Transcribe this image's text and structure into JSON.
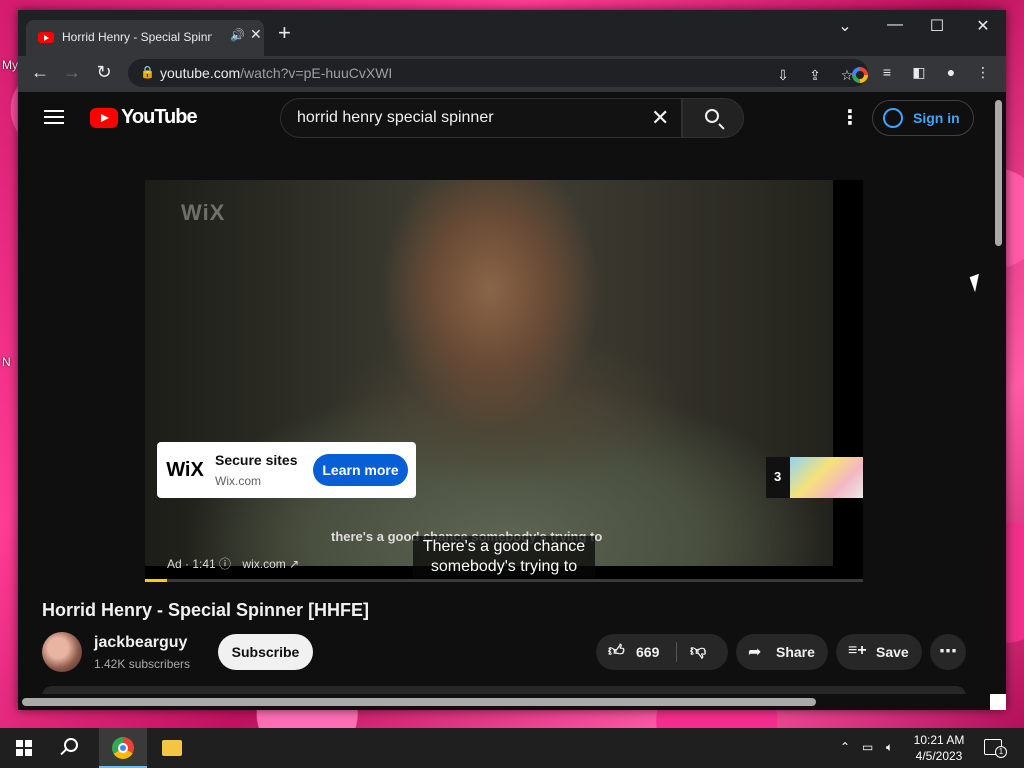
{
  "desktop": {
    "label_top": "My",
    "label_bottom": "N"
  },
  "browser": {
    "tab_title": "Horrid Henry - Special Spinner [HHFE] - YouTube",
    "tab_audio_icon": "speaker-icon",
    "url_host": "youtube.com",
    "url_path": "/watch?v=pE-huuCvXWI"
  },
  "youtube": {
    "logo_text": "YouTube",
    "search_query": "horrid henry special spinner",
    "signin_label": "Sign in",
    "ad": {
      "watermark": "WiX",
      "logo_text": "WiX",
      "title": "Secure sites",
      "domain": "Wix.com",
      "cta": "Learn more",
      "caption_in_ad": "there's a good chance somebody's trying to",
      "info_label": "Ad · 1:41",
      "info_domain": "wix.com"
    },
    "caption_line1": "There's a good chance",
    "caption_line2": "somebody's trying to",
    "up_next_count": "3",
    "progress_fraction": 0.03,
    "video_title": "Horrid Henry - Special Spinner [HHFE]",
    "channel_name": "jackbearguy",
    "subscribers": "1.42K subscribers",
    "subscribe_label": "Subscribe",
    "like_count": "669",
    "share_label": "Share",
    "save_label": "Save"
  },
  "taskbar": {
    "time": "10:21 AM",
    "date": "4/5/2023",
    "notification_count": "1"
  }
}
